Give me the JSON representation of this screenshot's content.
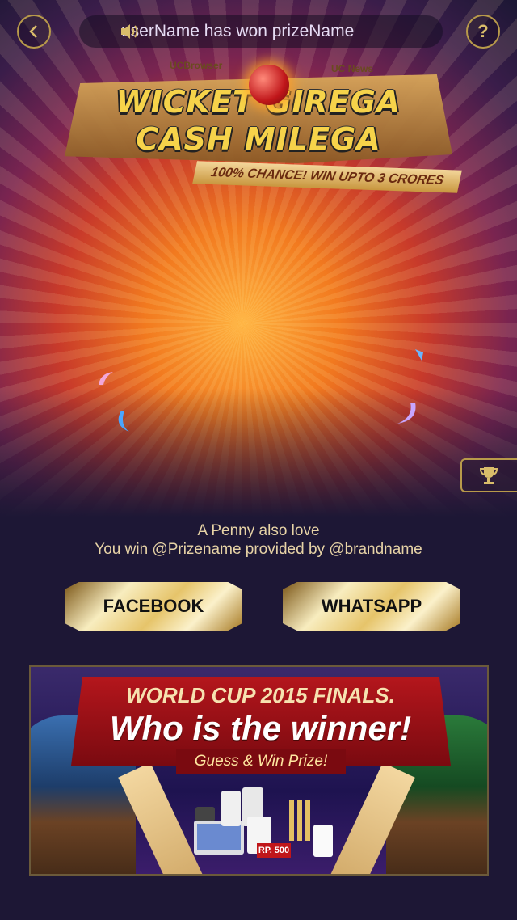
{
  "top_bar": {
    "back_icon": "chevron-left-icon",
    "help_label": "?",
    "marquee_text": "userName has won  prizeName"
  },
  "logo": {
    "brand_left": "UCBrowser",
    "brand_right": "UC News",
    "line1": "WICKET GIREGA",
    "line2": "CASH MILEGA",
    "tagline": "100% CHANCE!  WIN UPTO 3 CRORES"
  },
  "side_tab": {
    "icon": "trophy-icon"
  },
  "result": {
    "line1": "A Penny also love",
    "line2": "You win @Prizename provided by @brandname"
  },
  "share": {
    "facebook_label": "FACEBOOK",
    "whatsapp_label": "WHATSAPP"
  },
  "banner": {
    "title": "WORLD CUP 2015 FINALS.",
    "headline": "Who is the winner!",
    "subtitle": "Guess & Win Prize!",
    "prize_badge": "RP. 500"
  },
  "colors": {
    "background": "#1d1735",
    "gold": "#d9bc6a",
    "text": "#e7d3a6"
  }
}
